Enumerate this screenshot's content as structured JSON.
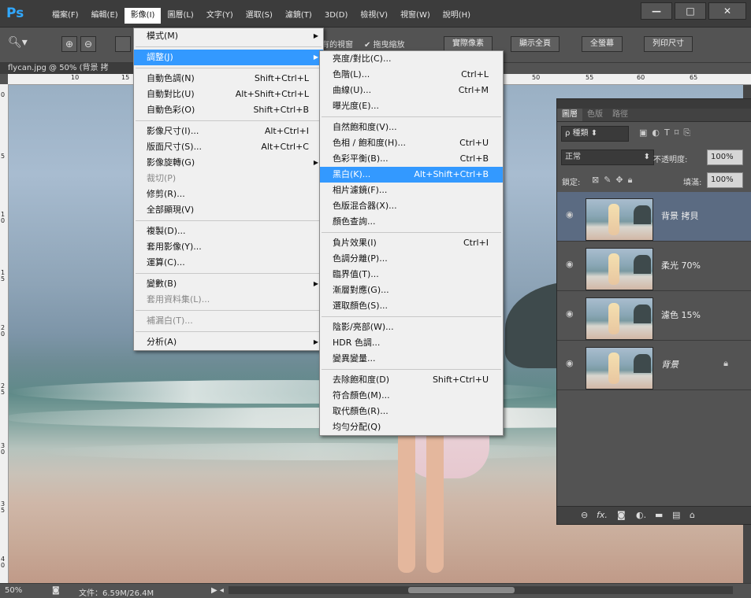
{
  "app": {
    "logo": "Ps",
    "menus": [
      "檔案(F)",
      "編輯(E)",
      "影像(I)",
      "圖層(L)",
      "文字(Y)",
      "選取(S)",
      "濾鏡(T)",
      "3D(D)",
      "檢視(V)",
      "視窗(W)",
      "說明(H)"
    ],
    "window_buttons": [
      "—",
      "□",
      "✕"
    ]
  },
  "options_bar": {
    "partial_text": "有的視窗",
    "checkbox_label": "拖曳縮放",
    "buttons": [
      "實際像素",
      "顯示全頁",
      "全螢幕",
      "列印尺寸"
    ]
  },
  "document": {
    "tab_title": "flycan.jpg @ 50% (背景 拷",
    "ruler_top": [
      "10",
      "15",
      "50",
      "55",
      "60",
      "65"
    ],
    "ruler_left": [
      "0",
      "5",
      "1\n0",
      "1\n5",
      "2\n0",
      "2\n5",
      "3\n0",
      "3\n5",
      "4\n0"
    ]
  },
  "image_menu": {
    "items": [
      {
        "label": "模式(M)",
        "shortcut": "",
        "arrow": true,
        "state": "normal"
      },
      {
        "sep": true
      },
      {
        "label": "調整(J)",
        "shortcut": "",
        "arrow": true,
        "state": "highlight"
      },
      {
        "sep": true
      },
      {
        "label": "自動色調(N)",
        "shortcut": "Shift+Ctrl+L",
        "arrow": false,
        "state": "normal"
      },
      {
        "label": "自動對比(U)",
        "shortcut": "Alt+Shift+Ctrl+L",
        "arrow": false,
        "state": "normal"
      },
      {
        "label": "自動色彩(O)",
        "shortcut": "Shift+Ctrl+B",
        "arrow": false,
        "state": "normal"
      },
      {
        "sep": true
      },
      {
        "label": "影像尺寸(I)...",
        "shortcut": "Alt+Ctrl+I",
        "arrow": false,
        "state": "normal"
      },
      {
        "label": "版面尺寸(S)...",
        "shortcut": "Alt+Ctrl+C",
        "arrow": false,
        "state": "normal"
      },
      {
        "label": "影像旋轉(G)",
        "shortcut": "",
        "arrow": true,
        "state": "normal"
      },
      {
        "label": "裁切(P)",
        "shortcut": "",
        "arrow": false,
        "state": "disabled"
      },
      {
        "label": "修剪(R)...",
        "shortcut": "",
        "arrow": false,
        "state": "normal"
      },
      {
        "label": "全部顯現(V)",
        "shortcut": "",
        "arrow": false,
        "state": "normal"
      },
      {
        "sep": true
      },
      {
        "label": "複製(D)...",
        "shortcut": "",
        "arrow": false,
        "state": "normal"
      },
      {
        "label": "套用影像(Y)...",
        "shortcut": "",
        "arrow": false,
        "state": "normal"
      },
      {
        "label": "運算(C)...",
        "shortcut": "",
        "arrow": false,
        "state": "normal"
      },
      {
        "sep": true
      },
      {
        "label": "變數(B)",
        "shortcut": "",
        "arrow": true,
        "state": "normal"
      },
      {
        "label": "套用資料集(L)...",
        "shortcut": "",
        "arrow": false,
        "state": "disabled"
      },
      {
        "sep": true
      },
      {
        "label": "補漏白(T)...",
        "shortcut": "",
        "arrow": false,
        "state": "disabled"
      },
      {
        "sep": true
      },
      {
        "label": "分析(A)",
        "shortcut": "",
        "arrow": true,
        "state": "normal"
      }
    ]
  },
  "adjust_menu": {
    "items": [
      {
        "label": "亮度/對比(C)...",
        "shortcut": "",
        "state": "normal"
      },
      {
        "label": "色階(L)...",
        "shortcut": "Ctrl+L",
        "state": "normal"
      },
      {
        "label": "曲線(U)...",
        "shortcut": "Ctrl+M",
        "state": "normal"
      },
      {
        "label": "曝光度(E)...",
        "shortcut": "",
        "state": "normal"
      },
      {
        "sep": true
      },
      {
        "label": "自然飽和度(V)...",
        "shortcut": "",
        "state": "normal"
      },
      {
        "label": "色相 / 飽和度(H)...",
        "shortcut": "Ctrl+U",
        "state": "normal"
      },
      {
        "label": "色彩平衡(B)...",
        "shortcut": "Ctrl+B",
        "state": "normal"
      },
      {
        "label": "黑白(K)...",
        "shortcut": "Alt+Shift+Ctrl+B",
        "state": "highlight"
      },
      {
        "label": "相片濾鏡(F)...",
        "shortcut": "",
        "state": "normal"
      },
      {
        "label": "色版混合器(X)...",
        "shortcut": "",
        "state": "normal"
      },
      {
        "label": "顏色查詢...",
        "shortcut": "",
        "state": "normal"
      },
      {
        "sep": true
      },
      {
        "label": "負片效果(I)",
        "shortcut": "Ctrl+I",
        "state": "normal"
      },
      {
        "label": "色調分離(P)...",
        "shortcut": "",
        "state": "normal"
      },
      {
        "label": "臨界值(T)...",
        "shortcut": "",
        "state": "normal"
      },
      {
        "label": "漸層對應(G)...",
        "shortcut": "",
        "state": "normal"
      },
      {
        "label": "選取顏色(S)...",
        "shortcut": "",
        "state": "normal"
      },
      {
        "sep": true
      },
      {
        "label": "陰影/亮部(W)...",
        "shortcut": "",
        "state": "normal"
      },
      {
        "label": "HDR 色調...",
        "shortcut": "",
        "state": "normal"
      },
      {
        "label": "變異變量...",
        "shortcut": "",
        "state": "normal"
      },
      {
        "sep": true
      },
      {
        "label": "去除飽和度(D)",
        "shortcut": "Shift+Ctrl+U",
        "state": "normal"
      },
      {
        "label": "符合顏色(M)...",
        "shortcut": "",
        "state": "normal"
      },
      {
        "label": "取代顏色(R)...",
        "shortcut": "",
        "state": "normal"
      },
      {
        "label": "均勻分配(Q)",
        "shortcut": "",
        "state": "normal"
      }
    ]
  },
  "layers_panel": {
    "tabs": [
      "圖層",
      "色版",
      "路徑"
    ],
    "filter_label": "ρ 種類",
    "blend_mode": "正常",
    "opacity_label": "不透明度:",
    "opacity_value": "100%",
    "lock_label": "鎖定:",
    "fill_label": "填滿:",
    "fill_value": "100%",
    "layers": [
      {
        "name": "背景 拷貝",
        "selected": true,
        "locked": false
      },
      {
        "name": "柔光 70%",
        "selected": false,
        "locked": false
      },
      {
        "name": "濾色 15%",
        "selected": false,
        "locked": false
      },
      {
        "name": "背景",
        "selected": false,
        "locked": true
      }
    ]
  },
  "status_bar": {
    "zoom": "50%",
    "file_info": "文件：6.59M/26.4M"
  }
}
